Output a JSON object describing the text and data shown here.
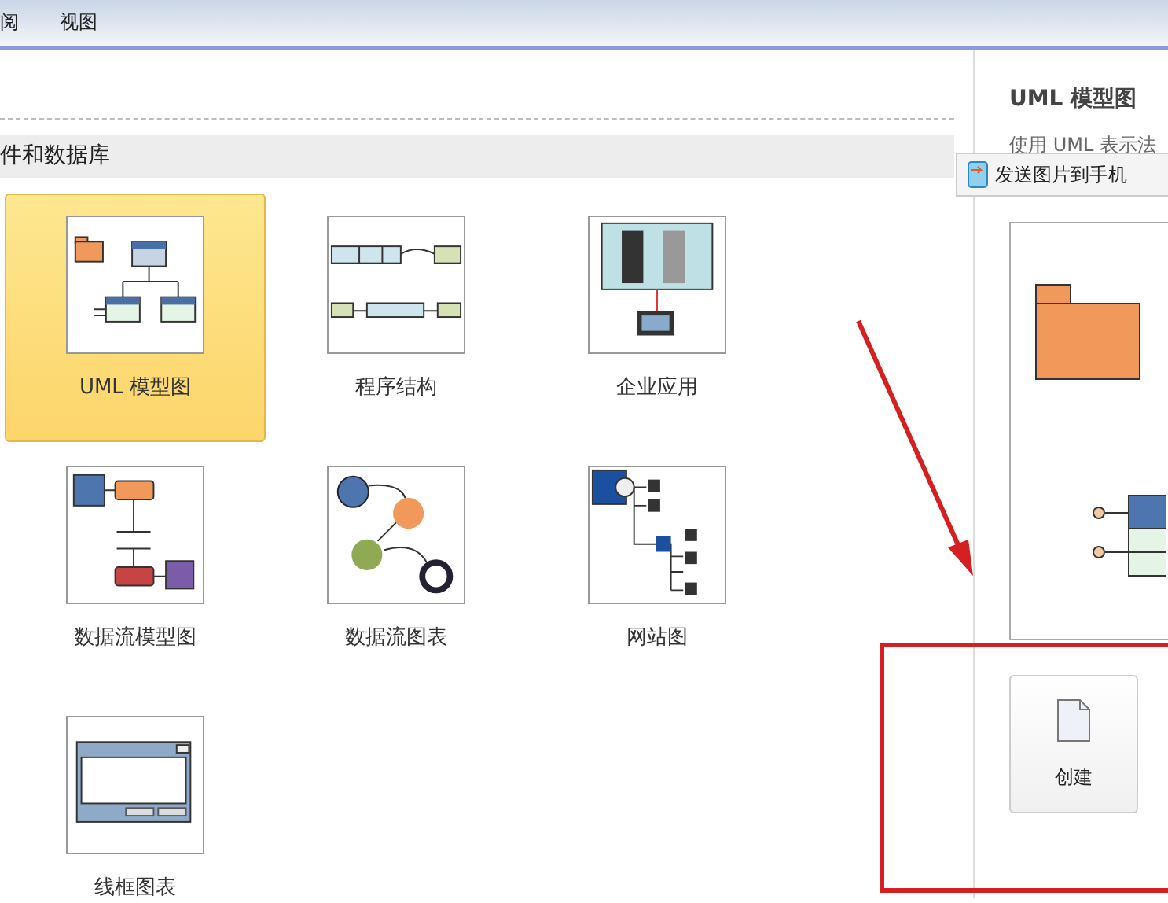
{
  "ribbon": {
    "tabs": [
      {
        "label": "阅",
        "selected": false
      },
      {
        "label": "视图",
        "selected": false
      }
    ]
  },
  "category": {
    "title": "件和数据库"
  },
  "templates": [
    {
      "label": "UML 模型图",
      "kind": "uml",
      "selected": true
    },
    {
      "label": "程序结构",
      "kind": "program",
      "selected": false
    },
    {
      "label": "企业应用",
      "kind": "enterprise",
      "selected": false
    },
    {
      "label": "数据流模型图",
      "kind": "dfmodel",
      "selected": false
    },
    {
      "label": "数据流图表",
      "kind": "dfchart",
      "selected": false
    },
    {
      "label": "网站图",
      "kind": "website",
      "selected": false
    },
    {
      "label": "线框图表",
      "kind": "wireframe",
      "selected": false
    }
  ],
  "details": {
    "title": "UML 模型图",
    "description": "使用 UML 表示法",
    "send_button": "发送图片到手机",
    "create_button": "创建"
  }
}
